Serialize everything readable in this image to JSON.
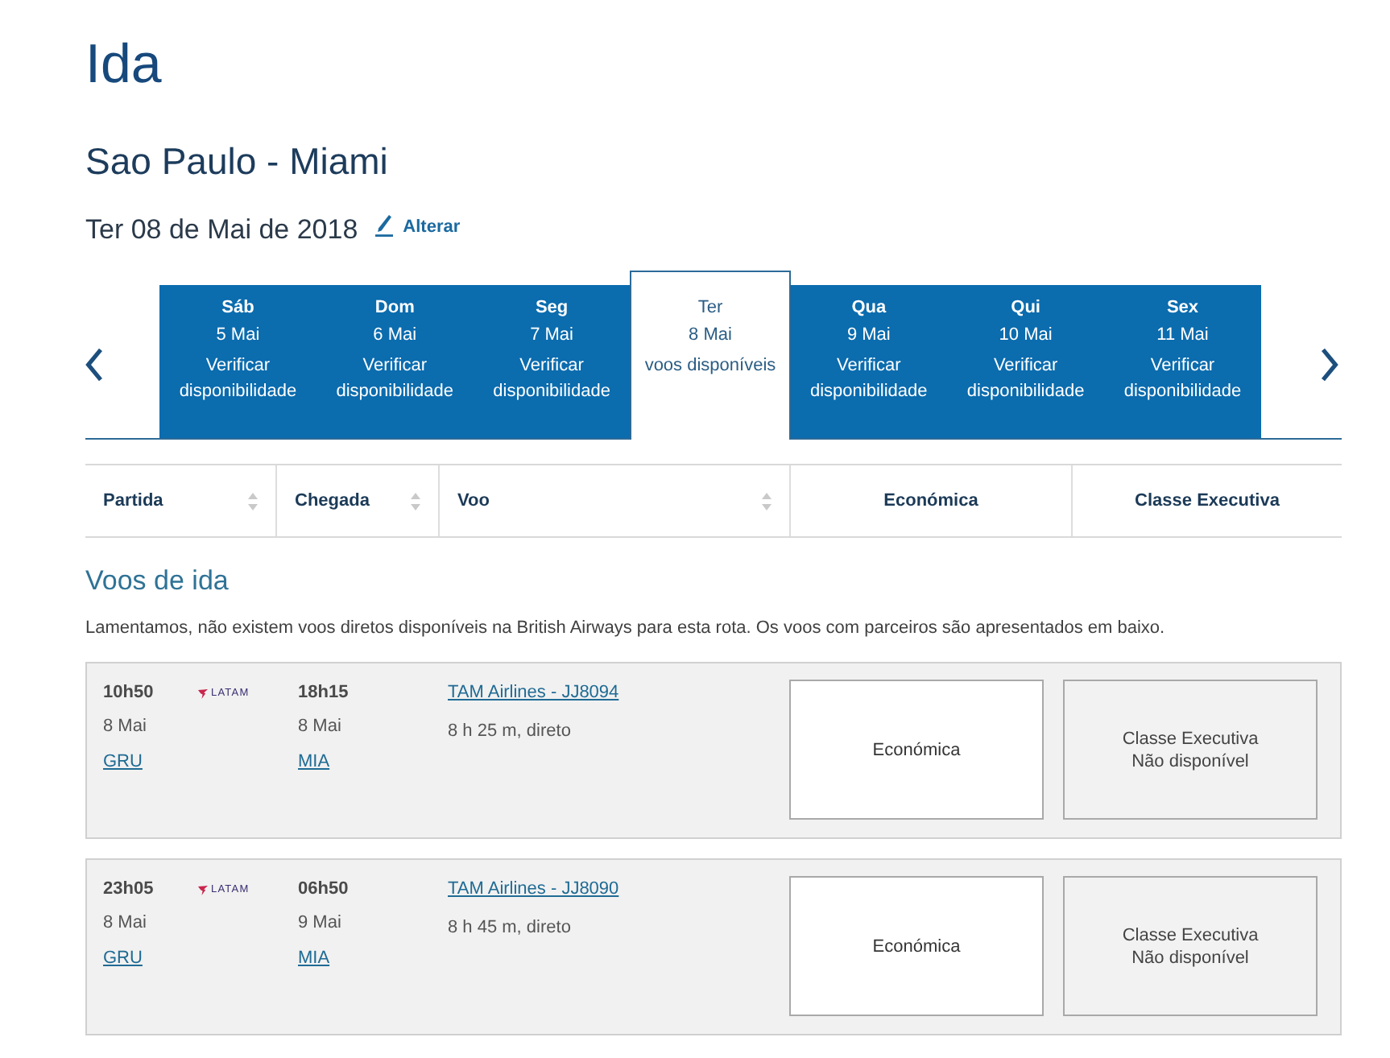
{
  "heading": "Ida",
  "route": "Sao Paulo - Miami",
  "date": {
    "label": "Ter 08 de Mai de 2018",
    "change_link": "Alterar"
  },
  "date_tabs": [
    {
      "day": "Sáb",
      "date": "5 Mai",
      "status": "Verificar disponibilidade",
      "selected": false
    },
    {
      "day": "Dom",
      "date": "6 Mai",
      "status": "Verificar disponibilidade",
      "selected": false
    },
    {
      "day": "Seg",
      "date": "7 Mai",
      "status": "Verificar disponibilidade",
      "selected": false
    },
    {
      "day": "Ter",
      "date": "8 Mai",
      "status": "voos disponíveis",
      "selected": true
    },
    {
      "day": "Qua",
      "date": "9 Mai",
      "status": "Verificar disponibilidade",
      "selected": false
    },
    {
      "day": "Qui",
      "date": "10 Mai",
      "status": "Verificar disponibilidade",
      "selected": false
    },
    {
      "day": "Sex",
      "date": "11 Mai",
      "status": "Verificar disponibilidade",
      "selected": false
    }
  ],
  "table_header": {
    "columns": [
      {
        "label": "Partida",
        "sortable": true
      },
      {
        "label": "Chegada",
        "sortable": true
      },
      {
        "label": "Voo",
        "sortable": true
      },
      {
        "label": "Económica",
        "sortable": false
      },
      {
        "label": "Classe Executiva",
        "sortable": false
      }
    ]
  },
  "section_title": "Voos de ida",
  "notice": "Lamentamos, não existem voos diretos disponíveis na British Airways para esta rota. Os voos com parceiros são apresentados em baixo.",
  "flights": [
    {
      "departure": {
        "time": "10h50",
        "date": "8 Mai",
        "airport": "GRU"
      },
      "airline_logo": "LATAM",
      "arrival": {
        "time": "18h15",
        "date": "8 Mai",
        "airport": "MIA"
      },
      "flight": "TAM Airlines - JJ8094",
      "duration": "8 h 25 m, direto",
      "fares": [
        {
          "kind": "available",
          "label": "Económica"
        },
        {
          "kind": "unavailable",
          "label": "Classe Executiva",
          "note": "Não disponível"
        }
      ]
    },
    {
      "departure": {
        "time": "23h05",
        "date": "8 Mai",
        "airport": "GRU"
      },
      "airline_logo": "LATAM",
      "arrival": {
        "time": "06h50",
        "date": "9 Mai",
        "airport": "MIA"
      },
      "flight": "TAM Airlines - JJ8090",
      "duration": "8 h 45 m, direto",
      "fares": [
        {
          "kind": "available",
          "label": "Económica"
        },
        {
          "kind": "unavailable",
          "label": "Classe Executiva",
          "note": "Não disponível"
        }
      ]
    }
  ]
}
